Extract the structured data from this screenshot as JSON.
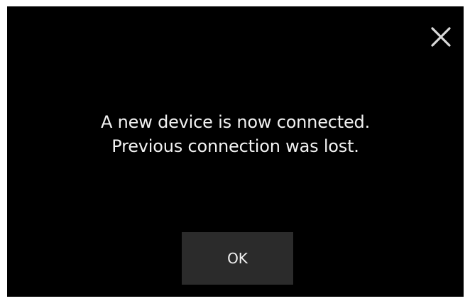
{
  "dialog": {
    "message_line1": "A new device is now connected.",
    "message_line2": "Previous connection was lost.",
    "ok_label": "OK",
    "close_icon": "close-icon"
  }
}
